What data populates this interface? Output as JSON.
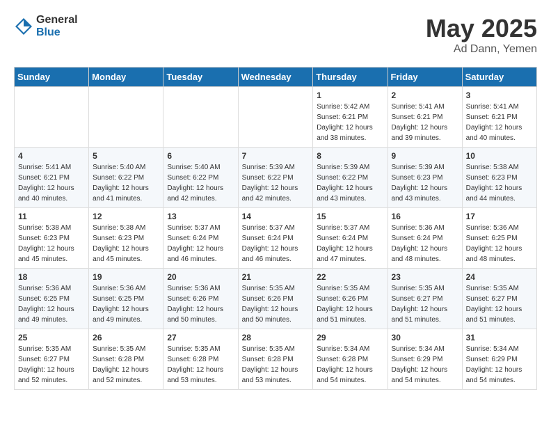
{
  "header": {
    "logo_general": "General",
    "logo_blue": "Blue",
    "title_month": "May 2025",
    "title_location": "Ad Dann, Yemen"
  },
  "calendar": {
    "days_of_week": [
      "Sunday",
      "Monday",
      "Tuesday",
      "Wednesday",
      "Thursday",
      "Friday",
      "Saturday"
    ],
    "weeks": [
      [
        {
          "day": "",
          "info": ""
        },
        {
          "day": "",
          "info": ""
        },
        {
          "day": "",
          "info": ""
        },
        {
          "day": "",
          "info": ""
        },
        {
          "day": "1",
          "info": "Sunrise: 5:42 AM\nSunset: 6:21 PM\nDaylight: 12 hours\nand 38 minutes."
        },
        {
          "day": "2",
          "info": "Sunrise: 5:41 AM\nSunset: 6:21 PM\nDaylight: 12 hours\nand 39 minutes."
        },
        {
          "day": "3",
          "info": "Sunrise: 5:41 AM\nSunset: 6:21 PM\nDaylight: 12 hours\nand 40 minutes."
        }
      ],
      [
        {
          "day": "4",
          "info": "Sunrise: 5:41 AM\nSunset: 6:21 PM\nDaylight: 12 hours\nand 40 minutes."
        },
        {
          "day": "5",
          "info": "Sunrise: 5:40 AM\nSunset: 6:22 PM\nDaylight: 12 hours\nand 41 minutes."
        },
        {
          "day": "6",
          "info": "Sunrise: 5:40 AM\nSunset: 6:22 PM\nDaylight: 12 hours\nand 42 minutes."
        },
        {
          "day": "7",
          "info": "Sunrise: 5:39 AM\nSunset: 6:22 PM\nDaylight: 12 hours\nand 42 minutes."
        },
        {
          "day": "8",
          "info": "Sunrise: 5:39 AM\nSunset: 6:22 PM\nDaylight: 12 hours\nand 43 minutes."
        },
        {
          "day": "9",
          "info": "Sunrise: 5:39 AM\nSunset: 6:23 PM\nDaylight: 12 hours\nand 43 minutes."
        },
        {
          "day": "10",
          "info": "Sunrise: 5:38 AM\nSunset: 6:23 PM\nDaylight: 12 hours\nand 44 minutes."
        }
      ],
      [
        {
          "day": "11",
          "info": "Sunrise: 5:38 AM\nSunset: 6:23 PM\nDaylight: 12 hours\nand 45 minutes."
        },
        {
          "day": "12",
          "info": "Sunrise: 5:38 AM\nSunset: 6:23 PM\nDaylight: 12 hours\nand 45 minutes."
        },
        {
          "day": "13",
          "info": "Sunrise: 5:37 AM\nSunset: 6:24 PM\nDaylight: 12 hours\nand 46 minutes."
        },
        {
          "day": "14",
          "info": "Sunrise: 5:37 AM\nSunset: 6:24 PM\nDaylight: 12 hours\nand 46 minutes."
        },
        {
          "day": "15",
          "info": "Sunrise: 5:37 AM\nSunset: 6:24 PM\nDaylight: 12 hours\nand 47 minutes."
        },
        {
          "day": "16",
          "info": "Sunrise: 5:36 AM\nSunset: 6:24 PM\nDaylight: 12 hours\nand 48 minutes."
        },
        {
          "day": "17",
          "info": "Sunrise: 5:36 AM\nSunset: 6:25 PM\nDaylight: 12 hours\nand 48 minutes."
        }
      ],
      [
        {
          "day": "18",
          "info": "Sunrise: 5:36 AM\nSunset: 6:25 PM\nDaylight: 12 hours\nand 49 minutes."
        },
        {
          "day": "19",
          "info": "Sunrise: 5:36 AM\nSunset: 6:25 PM\nDaylight: 12 hours\nand 49 minutes."
        },
        {
          "day": "20",
          "info": "Sunrise: 5:36 AM\nSunset: 6:26 PM\nDaylight: 12 hours\nand 50 minutes."
        },
        {
          "day": "21",
          "info": "Sunrise: 5:35 AM\nSunset: 6:26 PM\nDaylight: 12 hours\nand 50 minutes."
        },
        {
          "day": "22",
          "info": "Sunrise: 5:35 AM\nSunset: 6:26 PM\nDaylight: 12 hours\nand 51 minutes."
        },
        {
          "day": "23",
          "info": "Sunrise: 5:35 AM\nSunset: 6:27 PM\nDaylight: 12 hours\nand 51 minutes."
        },
        {
          "day": "24",
          "info": "Sunrise: 5:35 AM\nSunset: 6:27 PM\nDaylight: 12 hours\nand 51 minutes."
        }
      ],
      [
        {
          "day": "25",
          "info": "Sunrise: 5:35 AM\nSunset: 6:27 PM\nDaylight: 12 hours\nand 52 minutes."
        },
        {
          "day": "26",
          "info": "Sunrise: 5:35 AM\nSunset: 6:28 PM\nDaylight: 12 hours\nand 52 minutes."
        },
        {
          "day": "27",
          "info": "Sunrise: 5:35 AM\nSunset: 6:28 PM\nDaylight: 12 hours\nand 53 minutes."
        },
        {
          "day": "28",
          "info": "Sunrise: 5:35 AM\nSunset: 6:28 PM\nDaylight: 12 hours\nand 53 minutes."
        },
        {
          "day": "29",
          "info": "Sunrise: 5:34 AM\nSunset: 6:28 PM\nDaylight: 12 hours\nand 54 minutes."
        },
        {
          "day": "30",
          "info": "Sunrise: 5:34 AM\nSunset: 6:29 PM\nDaylight: 12 hours\nand 54 minutes."
        },
        {
          "day": "31",
          "info": "Sunrise: 5:34 AM\nSunset: 6:29 PM\nDaylight: 12 hours\nand 54 minutes."
        }
      ]
    ]
  }
}
